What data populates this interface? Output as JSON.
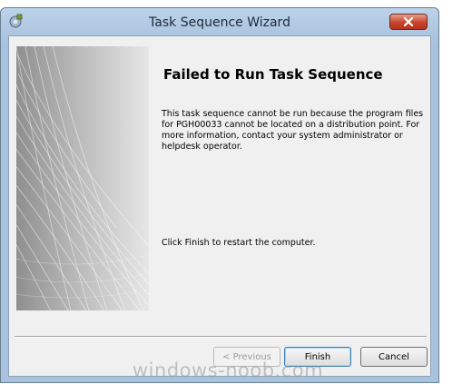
{
  "window": {
    "title": "Task Sequence Wizard",
    "close_icon": "close-icon",
    "app_icon": "task-sequence-icon"
  },
  "content": {
    "heading": "Failed to Run Task Sequence",
    "message": "This task sequence cannot be run because the program files for PGH00033 cannot be located on a distribution point. For more information, contact your system administrator or helpdesk operator.",
    "restart_note": "Click Finish to restart the computer."
  },
  "buttons": {
    "previous": "< Previous",
    "finish": "Finish",
    "cancel": "Cancel"
  },
  "watermark": "windows-noob.com",
  "colors": {
    "accent_close": "#c7432b",
    "titlebar": "#b0c8e2",
    "client_bg": "#f0f0f0"
  }
}
